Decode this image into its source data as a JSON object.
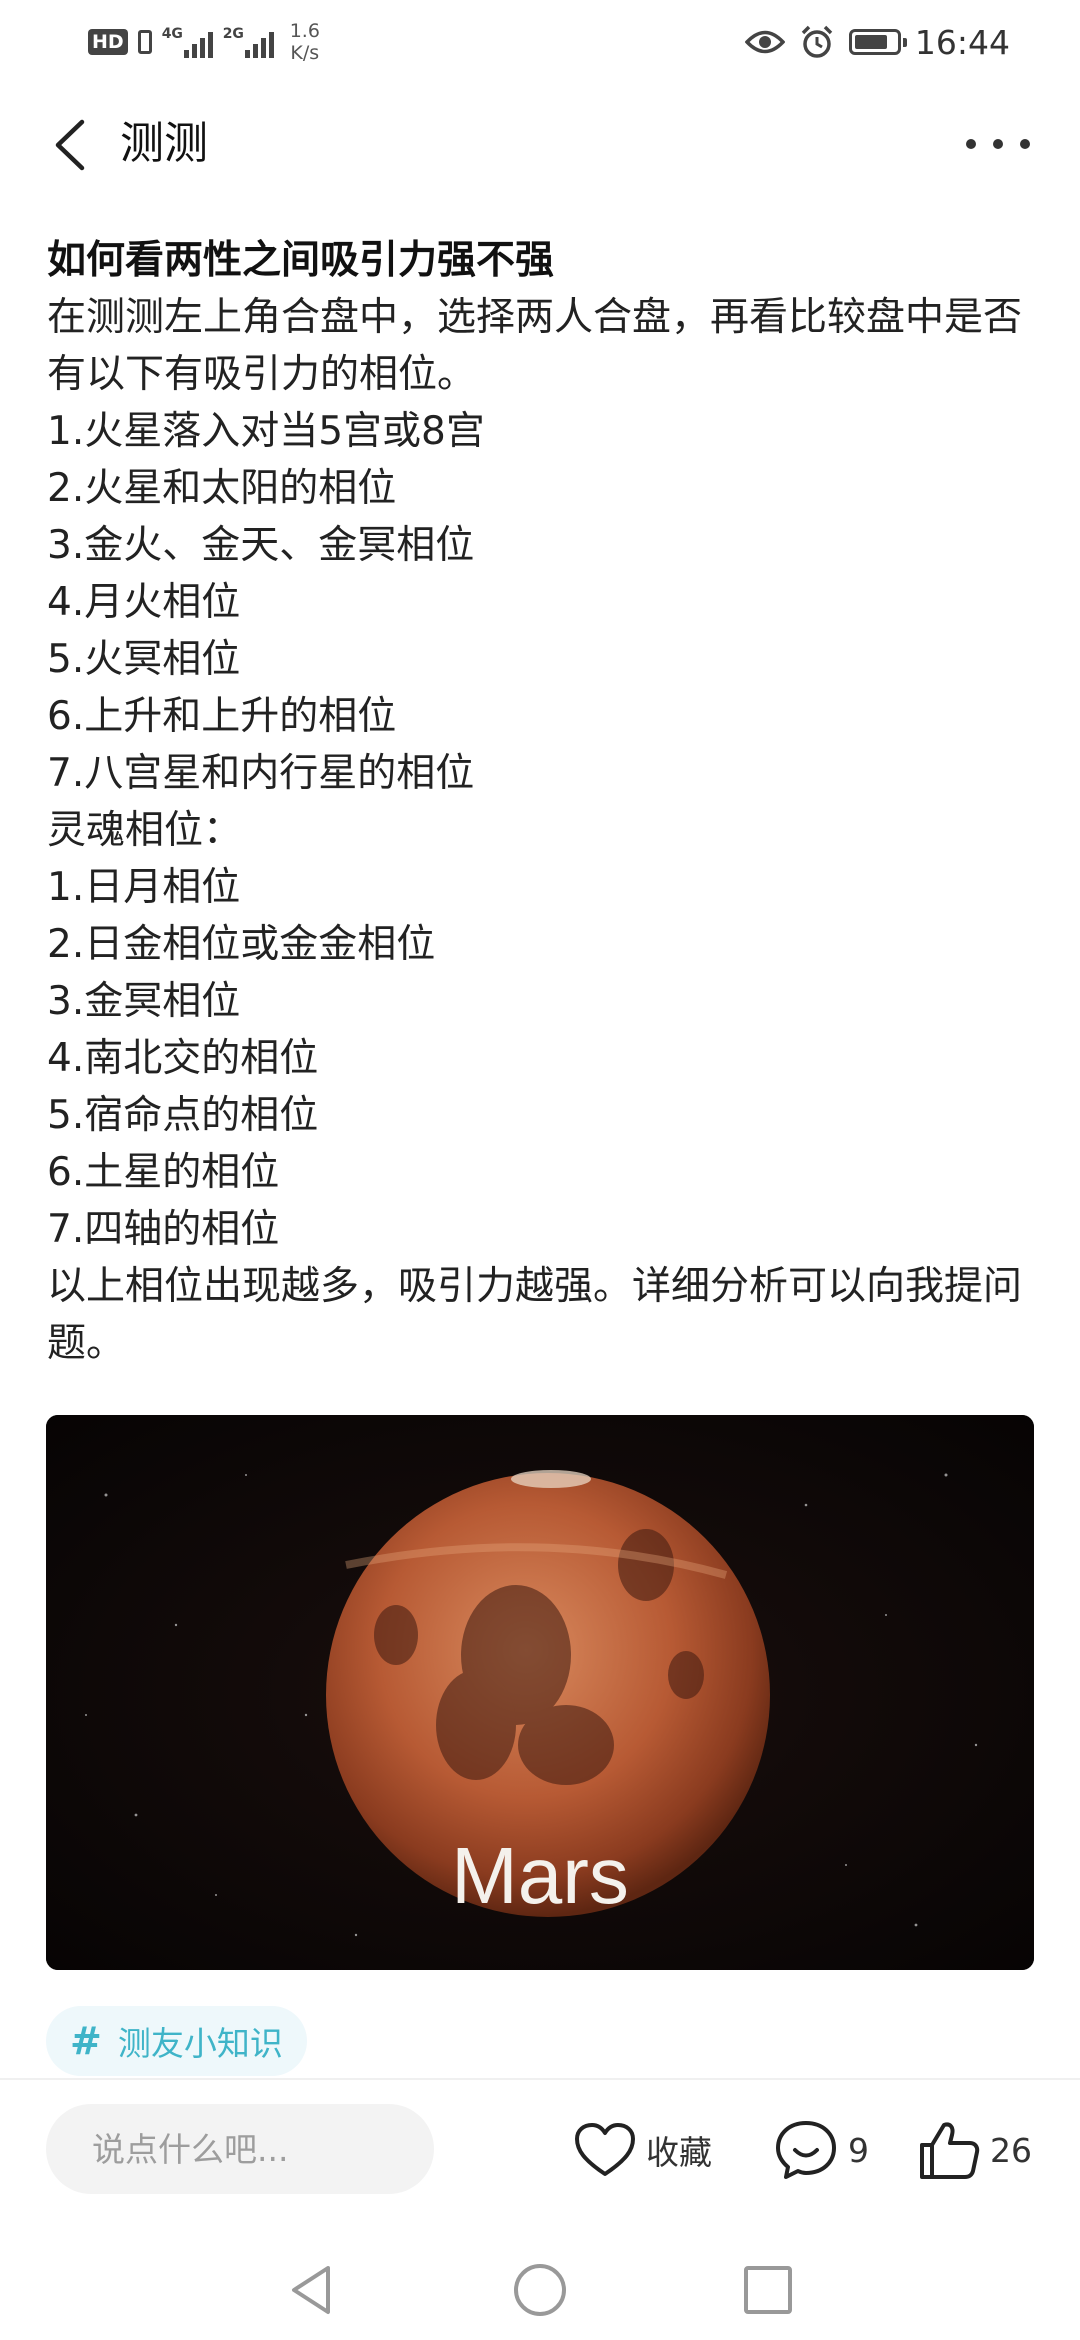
{
  "status_bar": {
    "hd": "HD",
    "sim1_network": "4G",
    "sim2_network": "2G",
    "speed_value": "1.6",
    "speed_unit": "K/s",
    "time": "16:44",
    "battery_level_percent": 80
  },
  "header": {
    "title": "测测"
  },
  "article": {
    "heading": "如何看两性之间吸引力强不强",
    "intro": "在测测左上角合盘中，选择两人合盘，再看比较盘中是否有以下有吸引力的相位。",
    "attraction_items": [
      "1.火星落入对当5宫或8宫",
      "2.火星和太阳的相位",
      "3.金火、金天、金冥相位",
      "4.月火相位",
      "5.火冥相位",
      "6.上升和上升的相位",
      "7.八宫星和内行星的相位"
    ],
    "soul_heading": "灵魂相位：",
    "soul_items": [
      "1.日月相位",
      "2.日金相位或金金相位",
      "3.金冥相位",
      "4.南北交的相位",
      "5.宿命点的相位",
      "6.土星的相位",
      "7.四轴的相位"
    ],
    "conclusion": "以上相位出现越多，吸引力越强。详细分析可以向我提问题。"
  },
  "image": {
    "caption": "Mars"
  },
  "tag": {
    "hash": "#",
    "label": "测友小知识"
  },
  "bottom_bar": {
    "comment_placeholder": "说点什么吧...",
    "favorite_label": "收藏",
    "comment_count": "9",
    "like_count": "26"
  }
}
